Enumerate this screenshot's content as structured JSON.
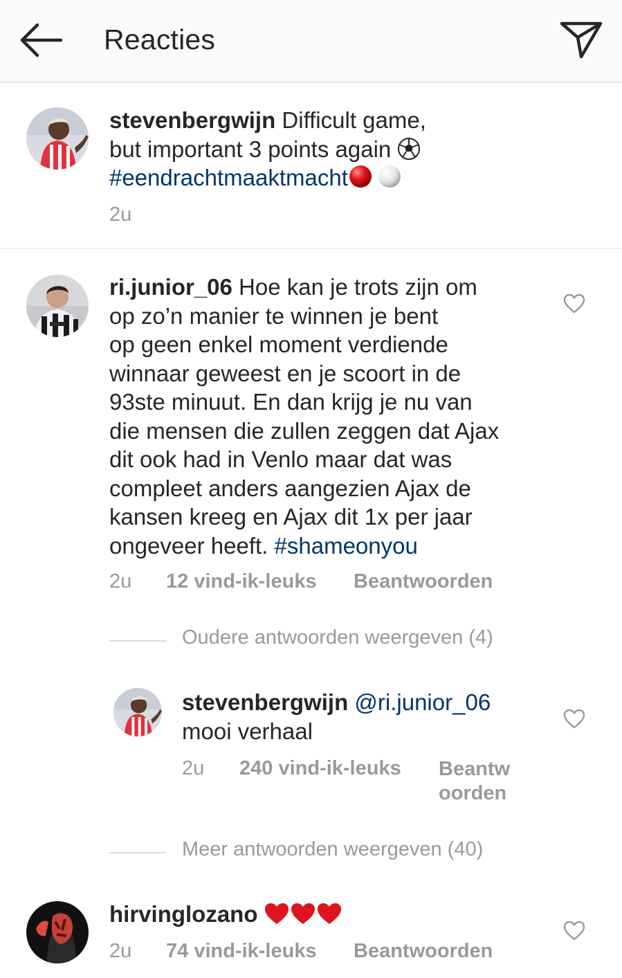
{
  "header": {
    "title": "Reacties",
    "back_icon": "arrow-left-icon",
    "send_icon": "paper-plane-icon"
  },
  "caption": {
    "username": "stevenbergwijn",
    "text_line1": " Difficult game,",
    "text_line2": "but important 3 points again ",
    "hashtag": "#eendrachtmaaktmacht",
    "time": "2u"
  },
  "comments": [
    {
      "username": "ri.junior_06",
      "lines": [
        " Hoe kan je trots zijn om",
        "op zo’n manier te winnen je bent",
        "op geen enkel moment verdiende",
        "winnaar geweest en je scoort in de",
        "93ste minuut. En dan krijg je nu van",
        "die mensen die zullen zeggen dat Ajax",
        "dit ook had in Venlo maar dat was",
        "compleet anders aangezien Ajax de",
        "kansen kreeg en Ajax dit 1x per jaar",
        "ongeveer heeft. "
      ],
      "hashtag": "#shameonyou",
      "time": "2u",
      "likes": "12 vind-ik-leuks",
      "reply": "Beantwoorden",
      "older_replies": "Oudere antwoorden weergeven (4)",
      "replies": [
        {
          "username": "stevenbergwijn",
          "mention": "@ri.junior_06",
          "text": "mooi verhaal",
          "time": "2u",
          "likes": "240 vind-ik-leuks",
          "reply_line1": "Beantw",
          "reply_line2": "oorden"
        }
      ],
      "more_replies": "Meer antwoorden weergeven (40)"
    },
    {
      "username": "hirvinglozano",
      "time": "2u",
      "likes": "74 vind-ik-leuks",
      "reply": "Beantwoorden"
    }
  ],
  "colors": {
    "text": "#262626",
    "secondary": "#999999",
    "link": "#003569",
    "header_bg": "#fafafa"
  }
}
